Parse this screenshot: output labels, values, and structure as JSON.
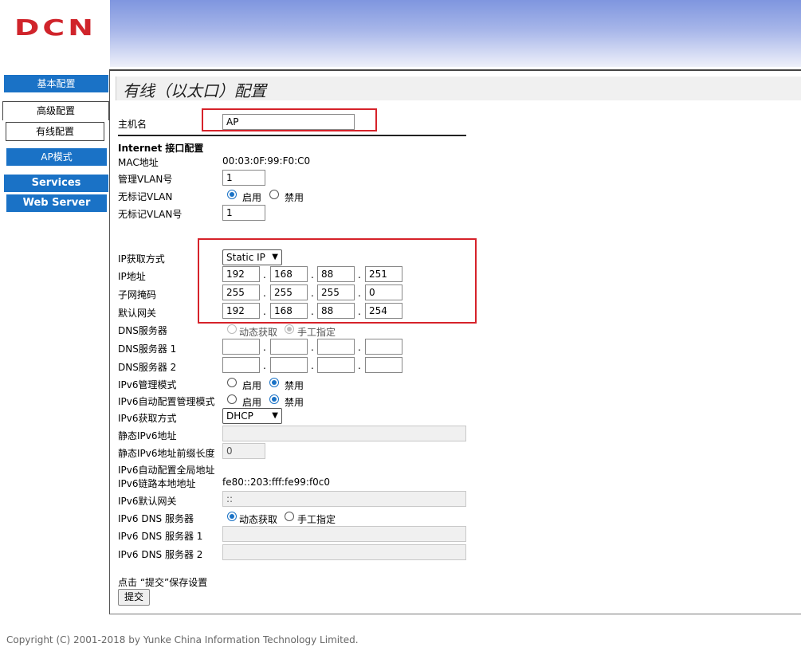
{
  "brand": {
    "logo_text": "DCN",
    "logo_color": "#d0242b"
  },
  "sidebar": {
    "basic": "基本配置",
    "advanced": "高级配置",
    "wired": "有线配置",
    "ap_mode": "AP模式",
    "services": "Services",
    "web_server": "Web Server"
  },
  "page": {
    "title": "有线（以太口）配置"
  },
  "form": {
    "hostname_label": "主机名",
    "hostname_value": "AP",
    "section_title": "Internet 接口配置",
    "mac_label": "MAC地址",
    "mac_value": "00:03:0F:99:F0:C0",
    "mgmt_vlan_label": "管理VLAN号",
    "mgmt_vlan_value": "1",
    "untagged_vlan_label": "无标记VLAN",
    "enable": "启用",
    "disable": "禁用",
    "untagged_vlan_id_label": "无标记VLAN号",
    "untagged_vlan_id_value": "1",
    "ip_mode_label": "IP获取方式",
    "ip_mode_value": "Static IP",
    "ip_label": "IP地址",
    "ip": [
      "192",
      "168",
      "88",
      "251"
    ],
    "mask_label": "子网掩码",
    "mask": [
      "255",
      "255",
      "255",
      "0"
    ],
    "gateway_label": "默认网关",
    "gateway": [
      "192",
      "168",
      "88",
      "254"
    ],
    "dns_label": "DNS服务器",
    "dns_dynamic": "动态获取",
    "dns_manual": "手工指定",
    "dns1_label": "DNS服务器 1",
    "dns2_label": "DNS服务器 2",
    "ipv6_mgmt_label": "IPv6管理模式",
    "ipv6_auto_label": "IPv6自动配置管理模式",
    "ipv6_mode_label": "IPv6获取方式",
    "ipv6_mode_value": "DHCP",
    "static_ipv6_label": "静态IPv6地址",
    "static_ipv6_prefix_label": "静态IPv6地址前缀长度",
    "static_ipv6_prefix_value": "0",
    "ipv6_auto_global_label": "IPv6自动配置全局地址",
    "ipv6_link_local_label": "IPv6链路本地地址",
    "ipv6_link_local_value": "fe80::203:fff:fe99:f0c0",
    "ipv6_gateway_label": "IPv6默认网关",
    "ipv6_gateway_value": "::",
    "ipv6_dns_label": "IPv6 DNS 服务器",
    "ipv6_dns1_label": "IPv6 DNS 服务器 1",
    "ipv6_dns2_label": "IPv6 DNS 服务器 2",
    "submit_hint": "点击 “提交”保存设置",
    "submit_button": "提交"
  },
  "footer": {
    "copyright": "Copyright (C) 2001-2018 by Yunke China Information Technology Limited."
  },
  "colors": {
    "nav_blue": "#1a72c6",
    "highlight_red": "#d6222a"
  }
}
